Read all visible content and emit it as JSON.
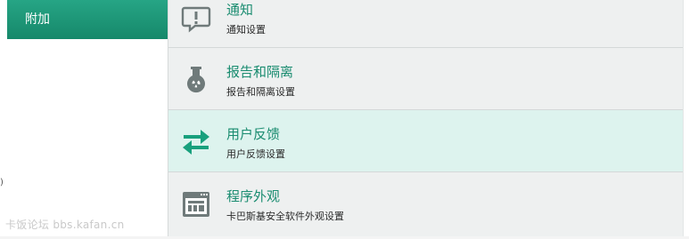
{
  "sidebar": {
    "items": [
      {
        "label": "附加",
        "selected": true
      }
    ],
    "accent_color": "#16886a"
  },
  "settings": {
    "rows": [
      {
        "title": "通知",
        "subtitle": "通知设置",
        "icon": "notification-icon"
      },
      {
        "title": "报告和隔离",
        "subtitle": "报告和隔离设置",
        "icon": "flask-icon"
      },
      {
        "title": "用户反馈",
        "subtitle": "用户反馈设置",
        "icon": "arrows-exchange-icon",
        "selected": true
      },
      {
        "title": "程序外观",
        "subtitle": "卡巴斯基安全软件外观设置",
        "icon": "window-appearance-icon"
      }
    ],
    "title_color": "#1a8c70",
    "selected_background": "#ddf3ee"
  },
  "watermark": {
    "text": "卡饭论坛 bbs.kafan.cn"
  },
  "edge_glyph": ")"
}
